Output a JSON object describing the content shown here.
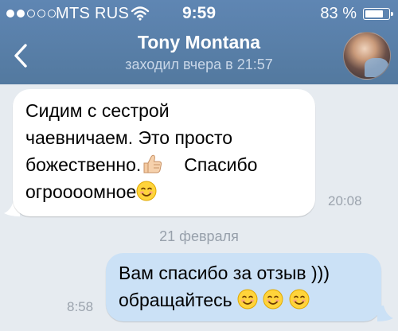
{
  "status_bar": {
    "carrier": "MTS RUS",
    "time": "9:59",
    "battery_percent": "83 %",
    "battery_level": 0.83,
    "signal_bars_filled": 2,
    "signal_bars_total": 5
  },
  "header": {
    "contact_name": "Tony Montana",
    "last_seen": "заходил вчера в 21:57"
  },
  "messages": [
    {
      "direction": "incoming",
      "lines": [
        "Сидим с сестрой",
        "чаевничаем. Это просто",
        "божественно.",
        "Спасибо",
        "огроооомное"
      ],
      "emoji": [
        "thumbs-up",
        "smiling-face"
      ],
      "time": "20:08"
    },
    {
      "direction": "outgoing",
      "lines": [
        "Вам спасибо за отзыв )))",
        "обращайтесь"
      ],
      "emoji": [
        "smiling-face",
        "smiling-face",
        "smiling-face"
      ],
      "time": "8:58"
    }
  ],
  "date_separator": "21 февраля",
  "colors": {
    "header": "#5a80ac",
    "background": "#e6ebf0",
    "incoming_bubble": "#ffffff",
    "outgoing_bubble": "#cbe1f6",
    "meta_text": "#9ba3ad"
  }
}
